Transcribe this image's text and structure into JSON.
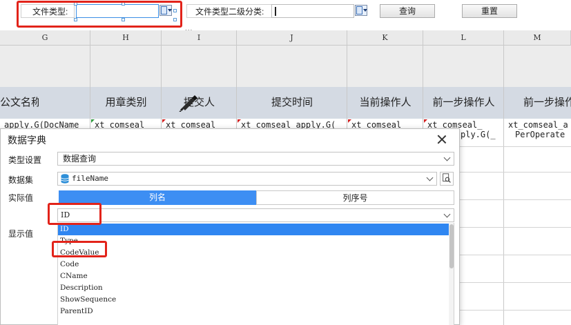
{
  "toolbar": {
    "file_type_label": "文件类型:",
    "file_type_value": "",
    "file_subtype_label": "文件类型二级分类:",
    "file_subtype_value": "",
    "query_button": "查询",
    "reset_button": "重置",
    "more_indicator": "..."
  },
  "sheet": {
    "columns": [
      "G",
      "H",
      "I",
      "J",
      "K",
      "L",
      "M"
    ],
    "headers": [
      "公文名称",
      "用章类别",
      "提交人",
      "提交时间",
      "当前操作人",
      "前一步操作人",
      "前一步操作"
    ],
    "row1": [
      "apply.G(DocName",
      "xt_comseal",
      "xt_comseal",
      "xt_comseal_apply.G(",
      "xt_comseal",
      "xt_comseal_",
      "xt_comseal_a"
    ],
    "row1_line2_l": "ply.G(_",
    "row1_line2_m": "PerOperate"
  },
  "dialog": {
    "title": "数据字典",
    "type_label": "类型设置",
    "type_value": "数据查询",
    "dataset_label": "数据集",
    "dataset_value": "fileName",
    "actual_label": "实际值",
    "display_label": "显示值",
    "seg_column_name": "列名",
    "seg_column_index": "列序号",
    "actual_field_value": "ID",
    "list_items": [
      "ID",
      "Type",
      "CodeValue",
      "Code",
      "CName",
      "Description",
      "ShowSequence",
      "ParentID"
    ],
    "selected_item": "ID"
  },
  "colors": {
    "accent_blue": "#3d8ef3",
    "highlight_red": "#e2231a",
    "header_band": "#d4dae3"
  },
  "icons": [
    "dropdown-icon",
    "pen-icon",
    "close-icon",
    "database-icon",
    "chevron-down-icon",
    "search-doc-icon"
  ]
}
